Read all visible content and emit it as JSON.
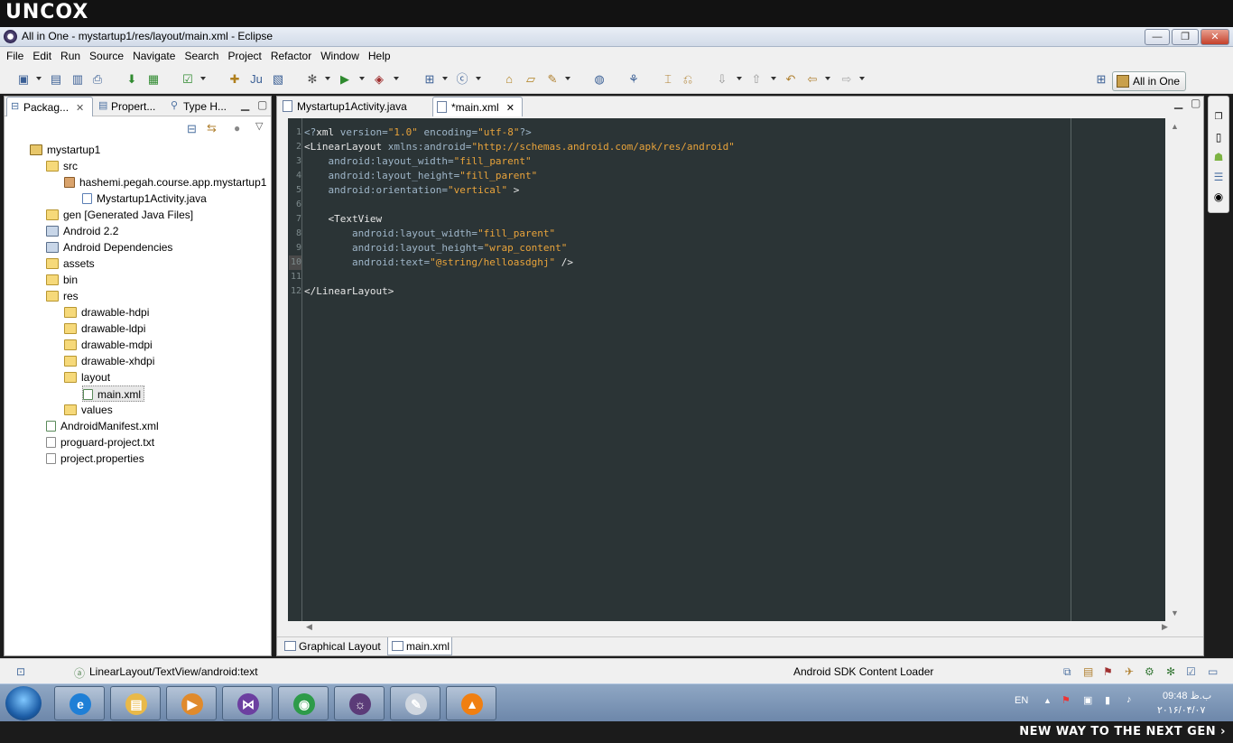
{
  "banner": {
    "brand": "UNCOX"
  },
  "window": {
    "title": "All in One - mystartup1/res/layout/main.xml - Eclipse",
    "min": "—",
    "max": "❐",
    "close": "✕"
  },
  "menu": [
    "File",
    "Edit",
    "Run",
    "Source",
    "Navigate",
    "Search",
    "Project",
    "Refactor",
    "Window",
    "Help"
  ],
  "perspective": {
    "label": "All in One"
  },
  "left_panel": {
    "tabs": [
      {
        "label": "Packag...",
        "icon": "package-explorer-icon",
        "close": "✕"
      },
      {
        "label": "Propert...",
        "icon": "properties-icon"
      },
      {
        "label": "Type H...",
        "icon": "type-hierarchy-icon"
      }
    ],
    "tree": [
      {
        "label": "mystartup1",
        "type": "proj"
      },
      {
        "label": "src",
        "type": "folder"
      },
      {
        "label": "hashemi.pegah.course.app.mystartup1",
        "type": "pkg"
      },
      {
        "label": "Mystartup1Activity.java",
        "type": "java"
      },
      {
        "label": "gen [Generated Java Files]",
        "type": "folder"
      },
      {
        "label": "Android 2.2",
        "type": "lib"
      },
      {
        "label": "Android Dependencies",
        "type": "lib"
      },
      {
        "label": "assets",
        "type": "folder"
      },
      {
        "label": "bin",
        "type": "folder"
      },
      {
        "label": "res",
        "type": "folder"
      },
      {
        "label": "drawable-hdpi",
        "type": "folder"
      },
      {
        "label": "drawable-ldpi",
        "type": "folder"
      },
      {
        "label": "drawable-mdpi",
        "type": "folder"
      },
      {
        "label": "drawable-xhdpi",
        "type": "folder"
      },
      {
        "label": "layout",
        "type": "folder"
      },
      {
        "label": "main.xml",
        "type": "xml"
      },
      {
        "label": "values",
        "type": "folder"
      },
      {
        "label": "AndroidManifest.xml",
        "type": "xml"
      },
      {
        "label": "proguard-project.txt",
        "type": "file"
      },
      {
        "label": "project.properties",
        "type": "file"
      }
    ]
  },
  "editor": {
    "tabs": [
      {
        "label": "Mystartup1Activity.java"
      },
      {
        "label": "*main.xml",
        "close": "✕"
      }
    ],
    "line_numbers": [
      "1",
      "2",
      "3",
      "4",
      "5",
      "6",
      "7",
      "8",
      "9",
      "10",
      "11",
      "12"
    ],
    "lines": [
      [
        {
          "t": "<?",
          "c": "pi"
        },
        {
          "t": "xml",
          "c": "tag"
        },
        {
          "t": " version=",
          "c": "attr"
        },
        {
          "t": "\"1.0\"",
          "c": "str"
        },
        {
          "t": " encoding=",
          "c": "attr"
        },
        {
          "t": "\"utf-8\"",
          "c": "str"
        },
        {
          "t": "?>",
          "c": "pi"
        }
      ],
      [
        {
          "t": "<LinearLayout",
          "c": "tag"
        },
        {
          "t": " xmlns:android=",
          "c": "attr"
        },
        {
          "t": "\"http://schemas.android.com/apk/res/android\"",
          "c": "str"
        }
      ],
      [
        {
          "t": "    android:layout_width=",
          "c": "attr"
        },
        {
          "t": "\"fill_parent\"",
          "c": "str"
        }
      ],
      [
        {
          "t": "    android:layout_height=",
          "c": "attr"
        },
        {
          "t": "\"fill_parent\"",
          "c": "str"
        }
      ],
      [
        {
          "t": "    android:orientation=",
          "c": "attr"
        },
        {
          "t": "\"vertical\"",
          "c": "str"
        },
        {
          "t": " >",
          "c": "tag"
        }
      ],
      [],
      [
        {
          "t": "    <TextView",
          "c": "tag"
        }
      ],
      [
        {
          "t": "        android:layout_width=",
          "c": "attr"
        },
        {
          "t": "\"fill_parent\"",
          "c": "str"
        }
      ],
      [
        {
          "t": "        android:layout_height=",
          "c": "attr"
        },
        {
          "t": "\"wrap_content\"",
          "c": "str"
        }
      ],
      [
        {
          "t": "        android:text=",
          "c": "attr"
        },
        {
          "t": "\"@string/helloasdghj\"",
          "c": "str"
        },
        {
          "t": " />",
          "c": "tag"
        }
      ],
      [],
      [
        {
          "t": "</LinearLayout>",
          "c": "tag"
        }
      ]
    ],
    "bottom_tabs": [
      {
        "label": "Graphical Layout"
      },
      {
        "label": "main.xml"
      }
    ]
  },
  "status": {
    "path": "LinearLayout/TextView/android:text",
    "loader": "Android SDK Content Loader"
  },
  "taskbar": {
    "apps": [
      {
        "name": "internet-explorer-icon",
        "glyph": "e",
        "color": "#1f7fd6"
      },
      {
        "name": "file-explorer-icon",
        "glyph": "▤",
        "color": "#e9b949"
      },
      {
        "name": "media-player-icon",
        "glyph": "▶",
        "color": "#e08a2c"
      },
      {
        "name": "visual-studio-icon",
        "glyph": "⋈",
        "color": "#6c3fa0"
      },
      {
        "name": "chrome-icon",
        "glyph": "◉",
        "color": "#2e9b4a"
      },
      {
        "name": "java-ee-ide-icon",
        "glyph": "☼",
        "color": "#5b3b78"
      },
      {
        "name": "notepad-icon",
        "glyph": "✎",
        "color": "#cfd6df"
      },
      {
        "name": "vlc-icon",
        "glyph": "▲",
        "color": "#f07f12"
      }
    ],
    "lang": "EN",
    "time": "09:48 ب.ظ",
    "date": "۲۰۱۶/۰۴/۰۷"
  },
  "footer": {
    "slogan": "NEW WAY TO THE NEXT GEN ›"
  }
}
